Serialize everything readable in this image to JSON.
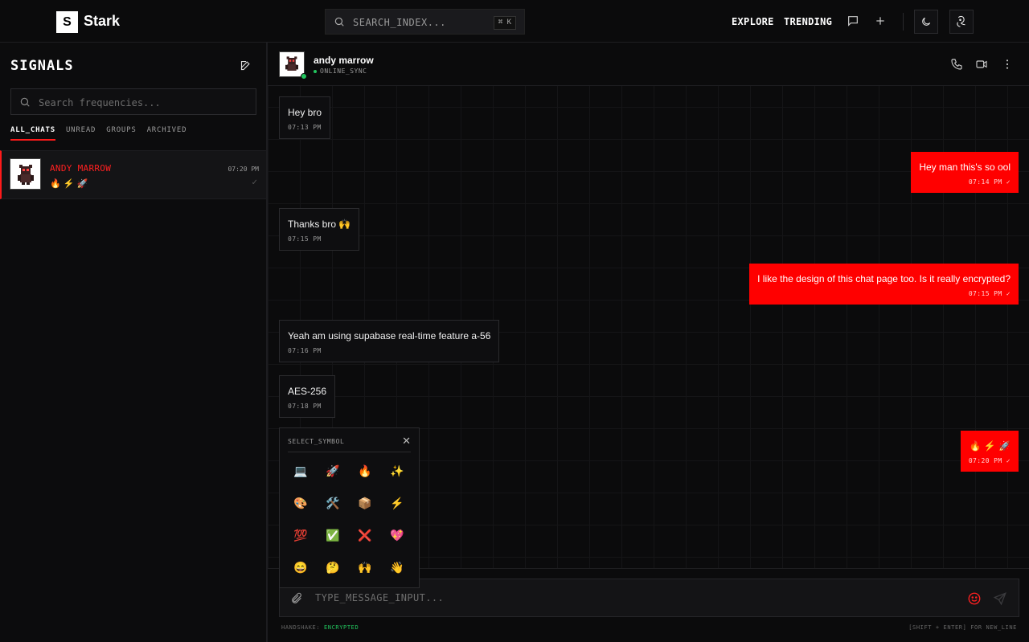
{
  "app": {
    "logo_letter": "S",
    "name": "Stark"
  },
  "topbar": {
    "search_placeholder": "SEARCH_INDEX...",
    "shortcut": "⌘ K",
    "nav": [
      "EXPLORE",
      "TRENDING"
    ]
  },
  "sidebar": {
    "title": "SIGNALS",
    "search_placeholder": "Search frequencies...",
    "filters": [
      "ALL_CHATS",
      "UNREAD",
      "GROUPS",
      "ARCHIVED"
    ],
    "active_filter": "ALL_CHATS",
    "chats": [
      {
        "name": "ANDY MARROW",
        "preview": "🔥 ⚡ 🚀",
        "time": "07:20 PM",
        "read": "✓"
      }
    ]
  },
  "chat": {
    "name": "andy marrow",
    "status": "ONLINE_SYNC",
    "messages": [
      {
        "dir": "in",
        "text": "Hey bro",
        "time": "07:13 PM"
      },
      {
        "dir": "out",
        "text": "Hey man this's so ool",
        "time": "07:14 PM ✓"
      },
      {
        "dir": "in",
        "text": "Thanks bro 🙌",
        "time": "07:15 PM"
      },
      {
        "dir": "out",
        "text": "I like the design of this chat page too. Is it really encrypted?",
        "time": "07:15 PM ✓"
      },
      {
        "dir": "in",
        "text": "Yeah am using supabase real-time feature a-56",
        "time": "07:16 PM"
      },
      {
        "dir": "in",
        "text": "AES-256",
        "time": "07:18 PM"
      },
      {
        "dir": "out",
        "text": "🔥 ⚡ 🚀",
        "time": "07:20 PM ✓"
      }
    ]
  },
  "picker": {
    "title": "SELECT_SYMBOL",
    "close": "✕",
    "symbols": [
      "💻",
      "🚀",
      "🔥",
      "✨",
      "🎨",
      "🛠️",
      "📦",
      "⚡",
      "💯",
      "✅",
      "❌",
      "💖",
      "😄",
      "🤔",
      "🙌",
      "👋"
    ]
  },
  "composer": {
    "placeholder": "TYPE_MESSAGE_INPUT...",
    "footer_left_label": "HANDSHAKE:",
    "footer_left_value": "ENCRYPTED",
    "footer_right": "[SHIFT + ENTER] FOR NEW_LINE"
  },
  "colors": {
    "accent": "#ff0000",
    "online": "#22c55e",
    "background": "#0b0b0c"
  },
  "icons": [
    "search-icon",
    "message-square-icon",
    "plus-icon",
    "moon-icon",
    "avatar-sketch-icon",
    "edit-icon",
    "phone-icon",
    "video-icon",
    "more-vertical-icon",
    "paperclip-icon",
    "smile-icon",
    "send-icon"
  ]
}
